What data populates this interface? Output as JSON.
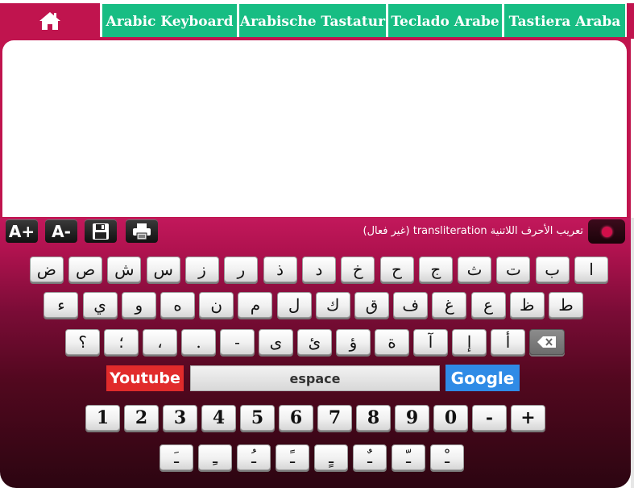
{
  "nav": {
    "home_icon": "home-icon",
    "tabs": [
      "Arabic Keyboard",
      "Arabische Tastatur",
      "Teclado Arabe",
      "Tastiera Araba"
    ]
  },
  "editor": {
    "value": ""
  },
  "toolbar": {
    "font_increase": "A+",
    "font_decrease": "A-",
    "save_icon": "floppy-disk-icon",
    "print_icon": "printer-icon",
    "transliteration_label": "تعريب الأحرف اللاتنية transliteration (غير فعال)",
    "toggle_icon": "toggle-icon"
  },
  "keyboard": {
    "row1": [
      "ا",
      "ب",
      "ت",
      "ث",
      "ج",
      "ح",
      "خ",
      "د",
      "ذ",
      "ر",
      "ز",
      "س",
      "ش",
      "ص",
      "ض"
    ],
    "row2": [
      "ط",
      "ظ",
      "ع",
      "غ",
      "ف",
      "ق",
      "ك",
      "ل",
      "م",
      "ن",
      "ه",
      "و",
      "ي",
      "ء"
    ],
    "row3": [
      "backspace",
      "أ",
      "إ",
      "آ",
      "ة",
      "ؤ",
      "ئ",
      "ى",
      "-",
      ".",
      "،",
      "؛",
      "؟"
    ],
    "youtube_label": "Youtube",
    "space_label": "espace",
    "google_label": "Google",
    "numbers": [
      "1",
      "2",
      "3",
      "4",
      "5",
      "6",
      "7",
      "8",
      "9",
      "0",
      "-",
      "+"
    ],
    "diacritics": [
      "ـَ",
      "ـِ",
      "ـُ",
      "ـً",
      "ـٍ",
      "ـٌ",
      "ـّ",
      "ـْ"
    ]
  },
  "colors": {
    "accent": "#c0144e",
    "tab_green": "#17bd83",
    "youtube_red": "#e12b2b",
    "google_blue": "#2f8be6"
  }
}
